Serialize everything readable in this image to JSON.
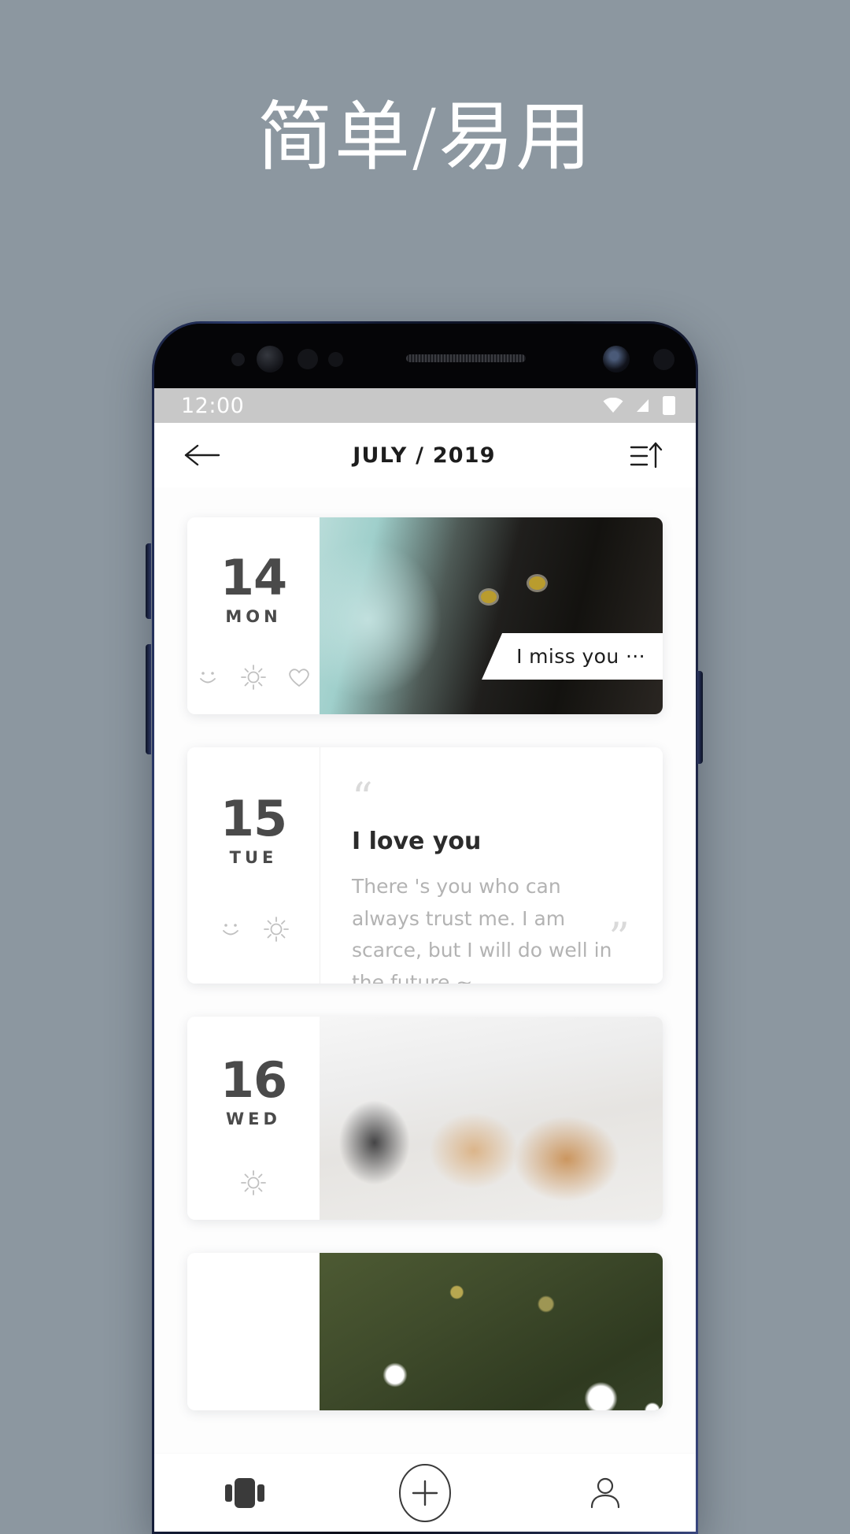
{
  "promo": {
    "headline": "简单/易用"
  },
  "status_bar": {
    "time": "12:00",
    "icons": [
      "wifi-icon",
      "cellular-signal-icon",
      "battery-icon"
    ]
  },
  "app_bar": {
    "back_icon": "arrow-left-icon",
    "title": "JULY / 2019",
    "sort_icon": "sort-ascending-icon"
  },
  "feed": {
    "entries": [
      {
        "day": "14",
        "weekday": "MON",
        "moods": [
          "smiley-icon",
          "sun-icon",
          "heart-icon"
        ],
        "type": "photo",
        "photo_alt": "cat-photo",
        "caption": "I miss you ···"
      },
      {
        "day": "15",
        "weekday": "TUE",
        "moods": [
          "smiley-icon",
          "sun-icon"
        ],
        "type": "quote",
        "quote_open": "“",
        "quote_close": "”",
        "title": "I love you",
        "body": "There 's you who can always trust me. I am scarce, but I will do well in the future ~"
      },
      {
        "day": "16",
        "weekday": "WED",
        "moods": [
          "sun-icon"
        ],
        "type": "photo",
        "photo_alt": "clothes-hangers-photo",
        "caption": ""
      },
      {
        "day": "",
        "weekday": "",
        "moods": [],
        "type": "photo",
        "photo_alt": "daisy-flowers-photo",
        "caption": ""
      }
    ]
  },
  "bottom_nav": {
    "items": [
      {
        "name": "cards-icon",
        "active": true
      },
      {
        "name": "add-circle-icon",
        "active": false
      },
      {
        "name": "profile-icon",
        "active": false
      }
    ]
  },
  "colors": {
    "page_background": "#8c97a0",
    "screen_background": "#ffffff",
    "status_bar": "#c8c8c8",
    "text_primary": "#2b2b2b",
    "text_muted": "#b3b3b3",
    "date_text": "#4a4a4a",
    "device_frame": "#2b3a6b"
  }
}
